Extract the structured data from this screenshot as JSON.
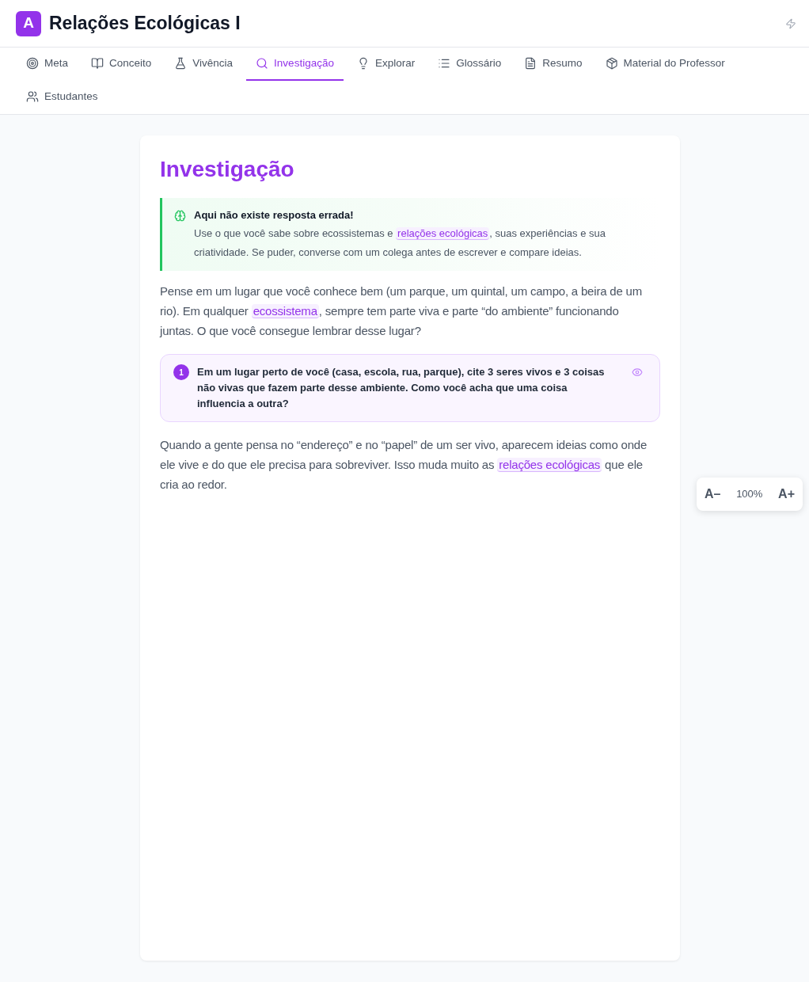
{
  "header": {
    "logo": "A",
    "title": "Relações Ecológicas I"
  },
  "tabs": [
    {
      "label": "Meta",
      "selected": false
    },
    {
      "label": "Conceito",
      "selected": false
    },
    {
      "label": "Vivência",
      "selected": false
    },
    {
      "label": "Investigação",
      "selected": true
    },
    {
      "label": "Explorar",
      "selected": false
    },
    {
      "label": "Glossário",
      "selected": false
    },
    {
      "label": "Resumo",
      "selected": false
    },
    {
      "label": "Material do Professor",
      "selected": false
    },
    {
      "label": "Estudantes",
      "selected": false
    }
  ],
  "content": {
    "heading": "Investigação",
    "callout": {
      "title": "Aqui não existe resposta errada!",
      "body": [
        {
          "kind": "text",
          "text": "Use o que você sabe sobre ecossistemas e "
        },
        {
          "kind": "term",
          "text": "relações ecológicas"
        },
        {
          "kind": "text",
          "text": ", suas experiências e sua criatividade. Se puder, converse com um colega antes de escrever e compare ideias."
        }
      ]
    },
    "blocks": [
      {
        "kind": "paragraph",
        "segments": [
          {
            "kind": "text",
            "text": "Pense em um lugar que você conhece bem (um parque, um quintal, um campo, a beira de um rio). Em qualquer "
          },
          {
            "kind": "term",
            "text": "ecossistema"
          },
          {
            "kind": "text",
            "text": ", sempre tem parte viva e parte “do ambiente” funcionando juntas. O que você consegue lembrar desse lugar?"
          }
        ]
      },
      {
        "kind": "question",
        "number": "1",
        "text": "Em um lugar perto de você (casa, escola, rua, parque), cite 3 seres vivos e 3 coisas não vivas que fazem parte desse ambiente. Como você acha que uma coisa influencia a outra?"
      },
      {
        "kind": "paragraph",
        "segments": [
          {
            "kind": "text",
            "text": "Quando a gente pensa no “endereço” e no “papel” de um ser vivo, aparecem ideias como onde ele vive e do que ele precisa para sobreviver. Isso muda muito as "
          },
          {
            "kind": "term",
            "text": "relações ecológicas"
          },
          {
            "kind": "text",
            "text": " que ele cria ao redor."
          }
        ]
      }
    ]
  },
  "font_control": {
    "decrease": "A–",
    "level_text": "100%",
    "increase": "A+"
  }
}
